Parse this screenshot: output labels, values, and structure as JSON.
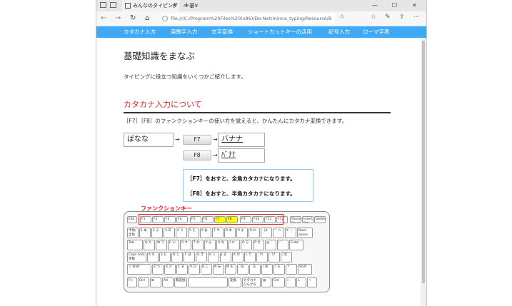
{
  "browser": {
    "tab_title": "みんなのタイピング　― 基",
    "new_tab": "+",
    "tab_menu": "∨",
    "address": "file:///C:/Program%20Files%20(x86)/De-Net/minna_typing/Resource/BasicKnowle",
    "back": "←",
    "forward": "→",
    "refresh": "↻",
    "home": "⌂",
    "star": "☆",
    "minimize": "—",
    "maximize": "☐",
    "close": "✕"
  },
  "menu": {
    "items": [
      "カタカナ入力",
      "英数字入力",
      "文字変換",
      "ショートカットキーの活用",
      "記号入力",
      "ローマ字表"
    ]
  },
  "page": {
    "title": "基礎知識をまなぶ",
    "lead": "タイピングに役立つ知識をいくつかご紹介します。",
    "section_title": "カタカナ入力について",
    "section_desc": "［F7］［F8］のファンクションキーの使い方を覚えると、かんたんにカタカナ変換できます。",
    "example": {
      "input": "ばなな",
      "arrow": "→",
      "key1": "F7",
      "out1": "バナナ",
      "key2": "F8",
      "out2": "ﾊﾞﾅﾅ"
    },
    "info": {
      "line1": "［F7］をおすと、全角カタカナになります。",
      "line2": "［F8］をおすと、半角カタカナになります。"
    },
    "function_key_label": "ファンクションキー",
    "keyboard": {
      "row0": [
        "ESC",
        "F1",
        "F2",
        "F3",
        "F4",
        "F5",
        "F6",
        "F7",
        "F8",
        "F9",
        "F10",
        "F11",
        "F12",
        "Pause Break",
        "Insert Prt Sc",
        "Delete"
      ],
      "row1": [
        "半角/全角",
        "1 ぬ",
        "2 ふ",
        "3 あ",
        "4 う",
        "5 え",
        "6 お",
        "7 や",
        "8 ゆ",
        "9 よ",
        "0 わ",
        "- ほ",
        "^ へ",
        "¥ ー",
        "Back space"
      ],
      "row2": [
        "Tab",
        "Q た",
        "W て",
        "E い",
        "R す",
        "T か",
        "Y ん",
        "U な",
        "I に",
        "O ら",
        "P せ",
        "@ ゛",
        "[ ゜",
        "Enter"
      ],
      "row3": [
        "Caps Lock 英数",
        "A ち",
        "S と",
        "D し",
        "F は",
        "G き",
        "H く",
        "J ま",
        "K の",
        "L り",
        "; れ",
        ": け",
        "] む"
      ],
      "row4": [
        "⇧ Shift",
        "Z つ",
        "X さ",
        "C そ",
        "V ひ",
        "B こ",
        "N み",
        "M も",
        ", ね",
        ". る",
        "/ め",
        "\\ ろ",
        "↑",
        "Shift"
      ],
      "row5": [
        "Fn",
        "Ctrl",
        "⊞",
        "Alt",
        "無変換",
        "",
        "変換",
        "カタカナ ひらがな",
        "▤",
        "Ctrl",
        "←",
        "↓",
        "→"
      ]
    }
  }
}
